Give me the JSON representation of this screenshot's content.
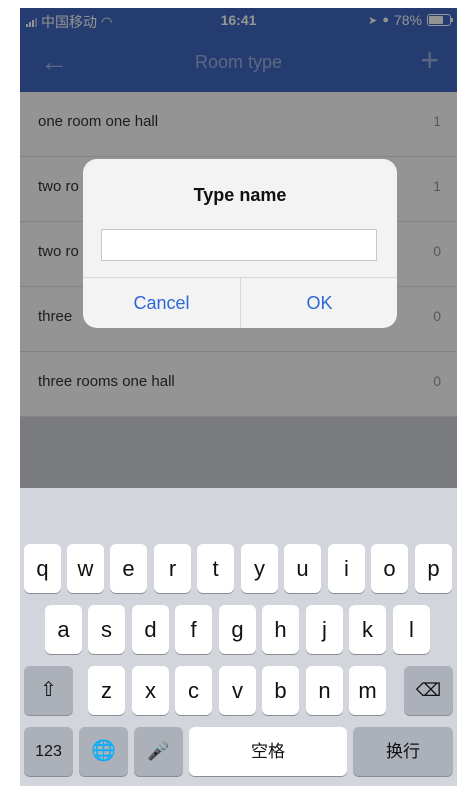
{
  "status_bar": {
    "carrier": "中国移动",
    "time": "16:41",
    "battery": "78%",
    "battery_level": 0.78
  },
  "nav": {
    "back_icon": "arrow-left-icon",
    "title": "Room type",
    "add_icon": "plus-icon"
  },
  "list": {
    "items": [
      {
        "name": "one room one hall",
        "count": "1"
      },
      {
        "name": "two ro",
        "count": "1"
      },
      {
        "name": "two ro",
        "count": "0"
      },
      {
        "name": "three",
        "count": "0"
      },
      {
        "name": "three rooms one hall",
        "count": "0"
      }
    ]
  },
  "dialog": {
    "title": "Type name",
    "input_value": "",
    "cancel_label": "Cancel",
    "ok_label": "OK"
  },
  "keyboard": {
    "row1": [
      "q",
      "w",
      "e",
      "r",
      "t",
      "y",
      "u",
      "i",
      "o",
      "p"
    ],
    "row2": [
      "a",
      "s",
      "d",
      "f",
      "g",
      "h",
      "j",
      "k",
      "l"
    ],
    "row3": [
      "z",
      "x",
      "c",
      "v",
      "b",
      "n",
      "m"
    ],
    "numbers_label": "123",
    "space_label": "空格",
    "return_label": "换行"
  },
  "colors": {
    "header": "#3f68c0",
    "accent": "#2f66d8"
  }
}
